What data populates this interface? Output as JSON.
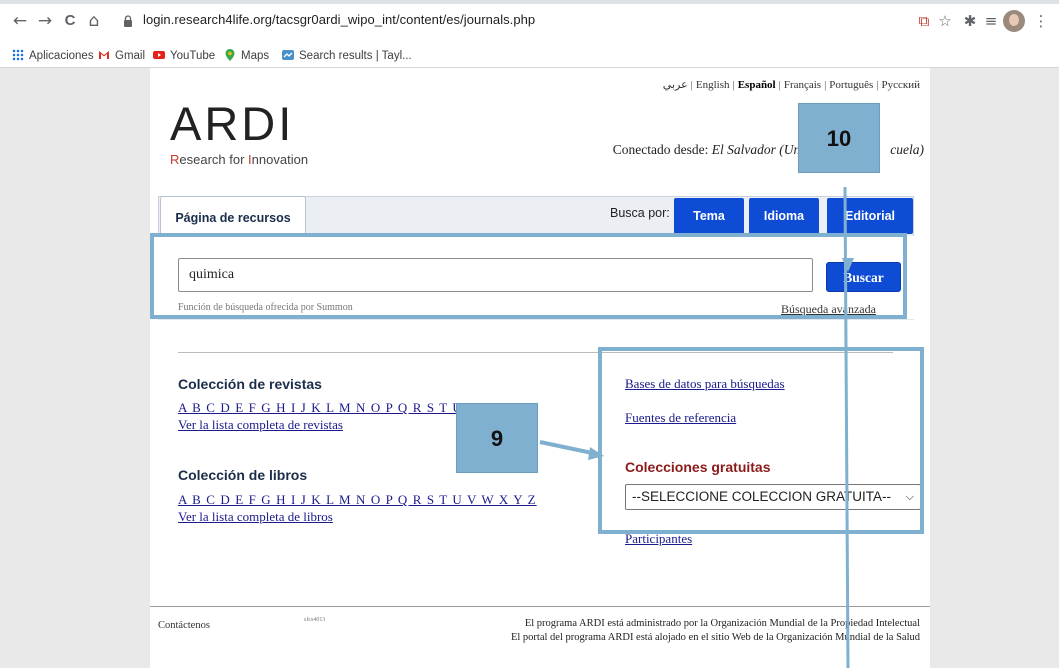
{
  "browser": {
    "url": "login.research4life.org/tacsgr0ardi_wipo_int/content/es/journals.php",
    "nav": {
      "back": "←",
      "forward": "→",
      "reload": "C",
      "home": "⌂"
    },
    "toolbar_icons": {
      "translate": "⧉",
      "bookmark": "☆",
      "extensions": "✱",
      "media": "≡"
    },
    "menu": "⋮",
    "bookmarks": [
      "Aplicaciones",
      "Gmail",
      "YouTube",
      "Maps",
      "Search results | Tayl..."
    ]
  },
  "languages": {
    "arabic": "عربي",
    "english": "English",
    "spanish": "Español",
    "french": "Français",
    "portuguese": "Português",
    "russian": "Русский",
    "separator": "|"
  },
  "logo": {
    "name": "ARDI",
    "tag_r": "R",
    "tag_rest1": "esearch for ",
    "tag_i": "I",
    "tag_rest2": "nnovation"
  },
  "connection": {
    "label": "Conectado desde: ",
    "place": "El Salvador (Universi",
    "tail": "cuela)"
  },
  "tabs": {
    "resources": "Página de recursos",
    "search_by": "Busca por:",
    "topic": "Tema",
    "language": "Idioma",
    "publisher": "Editorial"
  },
  "search": {
    "value": "quimica",
    "button": "Buscar",
    "powered_by": "Función de búsqueda ofrecida por Summon",
    "advanced": "Búsqueda avanzada"
  },
  "journals": {
    "title": "Colección de revistas",
    "letters": "A B C D E F G H I J K L M N O P Q R S T U V W X Y",
    "full_list": "Ver la lista completa de revistas"
  },
  "books": {
    "title": "Colección de libros",
    "letters": "A B C D E F G H I J K L M N O P Q R S T U V W X Y Z",
    "full_list": "Ver la lista completa de libros"
  },
  "links": {
    "databases": "Bases de datos para búsquedas",
    "references": "Fuentes de referencia",
    "free_title": "Colecciones gratuitas",
    "free_select": "--SELECCIONE COLECCION GRATUITA--",
    "participants": "Participantes"
  },
  "footer": {
    "contact": "Contáctenos",
    "build": "sfcs4013",
    "line1": "El programa ARDI está administrado por la Organización Mundial de la Propiedad Intelectual",
    "line2": "El portal del programa ARDI está alojado en el sitio Web de la Organización Mundial de la Salud"
  },
  "annotations": {
    "callout_10": "10",
    "callout_9": "9",
    "color": "#7fb0cf"
  }
}
